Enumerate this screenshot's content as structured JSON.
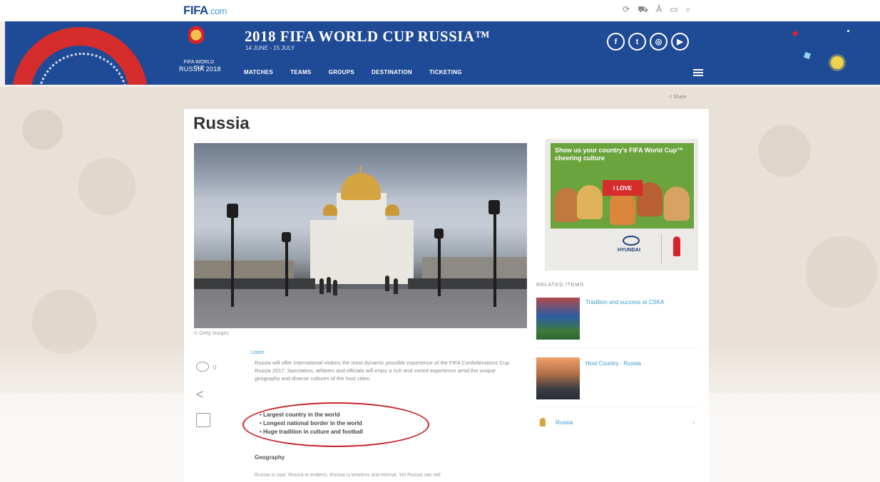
{
  "topbar": {
    "logo_main": "FIFA",
    "logo_dot": ".com",
    "icons": [
      "history-icon",
      "cart-icon",
      "user-icon",
      "language-icon",
      "search-icon"
    ],
    "icon_glyphs": [
      "⟳",
      "⛟",
      "Å",
      "▭",
      "⌕"
    ]
  },
  "header": {
    "emblem_line1": "FIFA WORLD CUP",
    "emblem_line2": "RUSSIA 2018",
    "title": "2018 FIFA WORLD CUP RUSSIA™",
    "dates": "14 JUNE - 15 JULY",
    "nav": [
      "MATCHES",
      "TEAMS",
      "GROUPS",
      "DESTINATION",
      "TICKETING"
    ],
    "social": [
      {
        "name": "facebook-icon",
        "glyph": "f"
      },
      {
        "name": "twitter-icon",
        "glyph": "t"
      },
      {
        "name": "instagram-icon",
        "glyph": "◎"
      },
      {
        "name": "youtube-icon",
        "glyph": "▶"
      }
    ]
  },
  "page": {
    "share_label": "Share",
    "title": "Russia",
    "image_caption": "© Getty Images",
    "comment_count": "0",
    "listen_label": "Listen",
    "intro": "Russia will offer international visitors the most dynamic possible experience of the FIFA Confederations Cup Russia 2017. Spectators, athletes and officials will enjoy a rich and varied experience amid the unique geography and diverse cultures of the host cities.",
    "bullets": [
      "Largest country in the world",
      "Longest national border in the world",
      "Huge tradition in culture and football"
    ],
    "geography_heading": "Geography",
    "geography_text": "Russia is vast. Russia is endless. Russia is timeless and eternal. Yet Russia can still"
  },
  "sidebar": {
    "ad_text": "Show us your country's FIFA World Cup™ cheering culture",
    "ad_banner": "I LOVE",
    "ad_brand": "HYUNDAI",
    "related_heading": "RELATED ITEMS",
    "related": [
      {
        "label": "Tradition and success at CSKA"
      },
      {
        "label": "Host Country : Russia"
      }
    ],
    "russia_link": "Russia"
  },
  "colors": {
    "header_blue": "#1f4b96",
    "accent_red": "#d62c2c",
    "link_blue": "#3a9acb",
    "ad_green": "#6ba43c"
  }
}
